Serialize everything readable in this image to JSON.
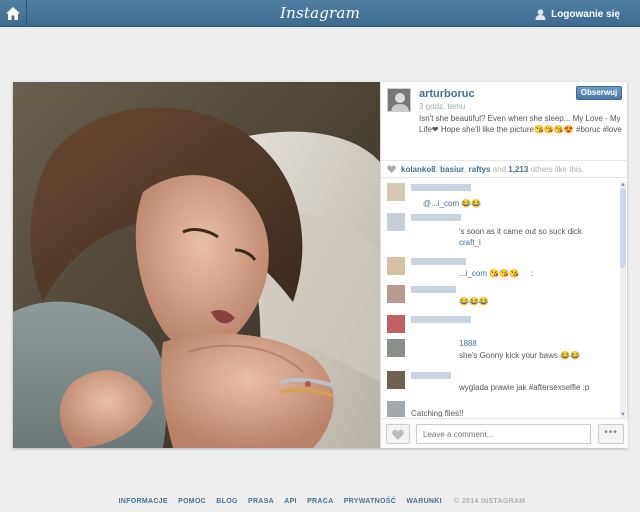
{
  "topbar": {
    "home_icon": "home-icon",
    "logo": "Instagram",
    "login_icon": "user-icon",
    "login_label": "Logowanie się"
  },
  "post": {
    "username": "arturboruc",
    "follow_label": "Obserwuj",
    "time": "3 godz. temu",
    "caption": "Isn't she beautiful? Even when she sleep... My Love - My Life❤ Hope she'll like the picture😘😘😘😍 #boruc #love",
    "likes": {
      "users": [
        "kolanko8",
        "basiur",
        "raftys"
      ],
      "separator_1": ",",
      "separator_2": ",",
      "conjunction": "and",
      "count": "1,213",
      "suffix": "others like this."
    },
    "comments": [
      {
        "fragment": "...",
        "handle": "@...i_com 😂😂",
        "text": ""
      },
      {
        "fragment": "'s soon as it came out so suck dick",
        "handle": "craft_i",
        "text": ""
      },
      {
        "fragment": "",
        "handle": "...i_com 😘😘😘",
        "text": ":"
      },
      {
        "fragment": "😂😂😂",
        "handle": "",
        "text": ""
      },
      {
        "fragment": "1888",
        "handle": "",
        "text": "she's Gonny kick your baws 😂😂"
      },
      {
        "fragment": "wyglada prawie jak #aftersexselfie :p",
        "handle": "",
        "text": ""
      },
      {
        "fragment": "Catching flies!!",
        "handle": "",
        "text": ""
      }
    ],
    "comment_placeholder": "Leave a comment...",
    "more_label": "•••",
    "heart_icon": "heart-icon"
  },
  "footer": {
    "links": [
      "INFORMACJE",
      "POMOC",
      "BLOG",
      "PRASA",
      "API",
      "PRACA",
      "PRYWATNOŚĆ",
      "WARUNKI"
    ],
    "copyright": "© 2014 INSTAGRAM"
  },
  "colors": {
    "topbar": "#3d6b91",
    "link": "#3f729b",
    "background": "#eeeeee"
  }
}
